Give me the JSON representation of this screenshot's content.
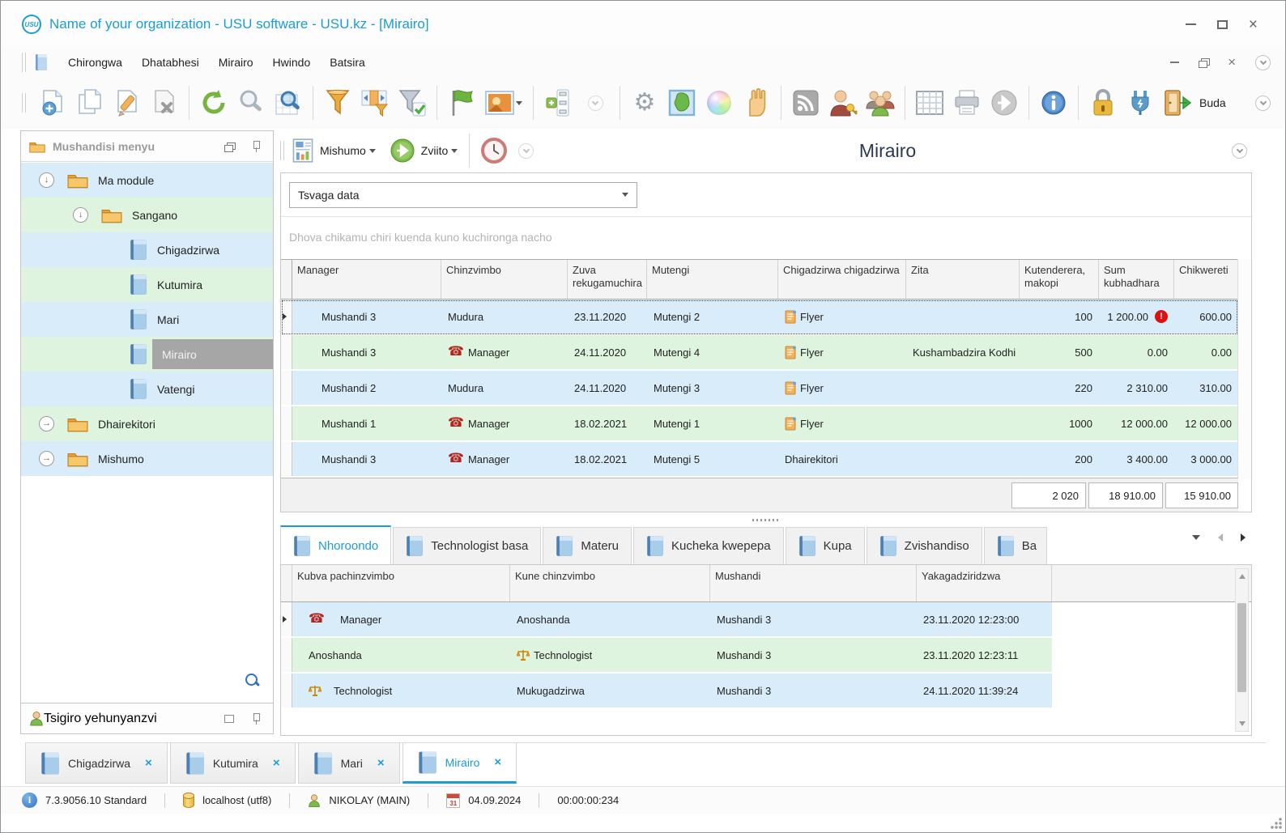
{
  "window": {
    "title": "Name of your organization - USU software - USU.kz - [Mirairo]",
    "logo_text": "USU"
  },
  "menubar": {
    "items": [
      "Chirongwa",
      "Dhatabhesi",
      "Mirairo",
      "Hwindo",
      "Batsira"
    ]
  },
  "toolbar": {
    "exit_label": "Buda"
  },
  "subtoolbar": {
    "reports_label": "Mishumo",
    "actions_label": "Zviito",
    "page_title": "Mirairo"
  },
  "sidebar": {
    "header": "Mushandisi menyu",
    "tree": [
      {
        "label": "Ma module"
      },
      {
        "label": "Sangano"
      },
      {
        "label": "Chigadzirwa"
      },
      {
        "label": "Kutumira"
      },
      {
        "label": "Mari"
      },
      {
        "label": "Mirairo"
      },
      {
        "label": "Vatengi"
      },
      {
        "label": "Dhairekitori"
      },
      {
        "label": "Mishumo"
      }
    ],
    "support_header": "Tsigiro yehunyanzvi"
  },
  "main": {
    "search_value": "Tsvaga data",
    "group_hint": "Dhova chikamu chiri kuenda kuno kuchironga nacho",
    "grid": {
      "columns": [
        "Manager",
        "Chinzvimbo",
        "Zuva rekugamuchira",
        "Mutengi",
        "Chigadzirwa chigadzirwa",
        "Zita",
        "Kutenderera, makopi",
        "Sum kubhadhara",
        "Chikwereti"
      ],
      "rows": [
        {
          "manager": "Mushandi 3",
          "chinzvimbo": "Mudura",
          "zuva": "23.11.2020",
          "mutengi": "Mutengi 2",
          "chigadzirwa": "Flyer",
          "zita": "",
          "kutenderera": "100",
          "sum": "1 200.00",
          "alert": "!",
          "chikwereti": "600.00"
        },
        {
          "manager": "Mushandi 3",
          "chinzvimbo": "Manager",
          "zuva": "24.11.2020",
          "mutengi": "Mutengi 4",
          "chigadzirwa": "Flyer",
          "zita": "Kushambadzira Kodhi",
          "kutenderera": "500",
          "sum": "0.00",
          "chikwereti": "0.00"
        },
        {
          "manager": "Mushandi 2",
          "chinzvimbo": "Mudura",
          "zuva": "24.11.2020",
          "mutengi": "Mutengi 3",
          "chigadzirwa": "Flyer",
          "zita": "",
          "kutenderera": "220",
          "sum": "2 310.00",
          "chikwereti": "310.00"
        },
        {
          "manager": "Mushandi 1",
          "chinzvimbo": "Manager",
          "zuva": "18.02.2021",
          "mutengi": "Mutengi 1",
          "chigadzirwa": "Flyer",
          "zita": "",
          "kutenderera": "1000",
          "sum": "12 000.00",
          "chikwereti": "12 000.00"
        },
        {
          "manager": "Mushandi 3",
          "chinzvimbo": "Manager",
          "zuva": "18.02.2021",
          "mutengi": "Mutengi 5",
          "chigadzirwa": "Dhairekitori",
          "zita": "",
          "kutenderera": "200",
          "sum": "3 400.00",
          "chikwereti": "3 000.00"
        }
      ],
      "summary": {
        "kutenderera": "2 020",
        "sum": "18 910.00",
        "chikwereti": "15 910.00"
      }
    },
    "detail_tabs": [
      "Nhoroondo",
      "Technologist basa",
      "Materu",
      "Kucheka kwepepa",
      "Kupa",
      "Zvishandiso",
      "Ba"
    ],
    "detail_grid": {
      "columns": [
        "Kubva pachinzvimbo",
        "Kune chinzvimbo",
        "Mushandi",
        "Yakagadziridzwa"
      ],
      "rows": [
        {
          "kubva": "Manager",
          "kune": "Anoshanda",
          "mushandi": "Mushandi 3",
          "yakagadziridzwa": "23.11.2020 12:23:00"
        },
        {
          "kubva": "Anoshanda",
          "kune": "Technologist",
          "mushandi": "Mushandi 3",
          "yakagadziridzwa": "23.11.2020 12:23:11"
        },
        {
          "kubva": "Technologist",
          "kune": "Mukugadzirwa",
          "mushandi": "Mushandi 3",
          "yakagadziridzwa": "24.11.2020 11:39:24"
        }
      ]
    }
  },
  "bottom_tabs": [
    {
      "label": "Chigadzirwa"
    },
    {
      "label": "Kutumira"
    },
    {
      "label": "Mari"
    },
    {
      "label": "Mirairo"
    }
  ],
  "statusbar": {
    "version": "7.3.9056.10 Standard",
    "database": "localhost (utf8)",
    "user": "NIKOLAY (MAIN)",
    "date": "04.09.2024",
    "timer": "00:00:00:234"
  },
  "icons": {
    "phone": "telephone-red",
    "scales": "balance-gold",
    "flyer": "orange-document",
    "folder": "orange-folder",
    "book": "blue-book",
    "accent_blue": "#1a9cd8",
    "row_blue": "#d8ecfa",
    "row_green": "#def4de",
    "alert_red": "#dd1111"
  }
}
